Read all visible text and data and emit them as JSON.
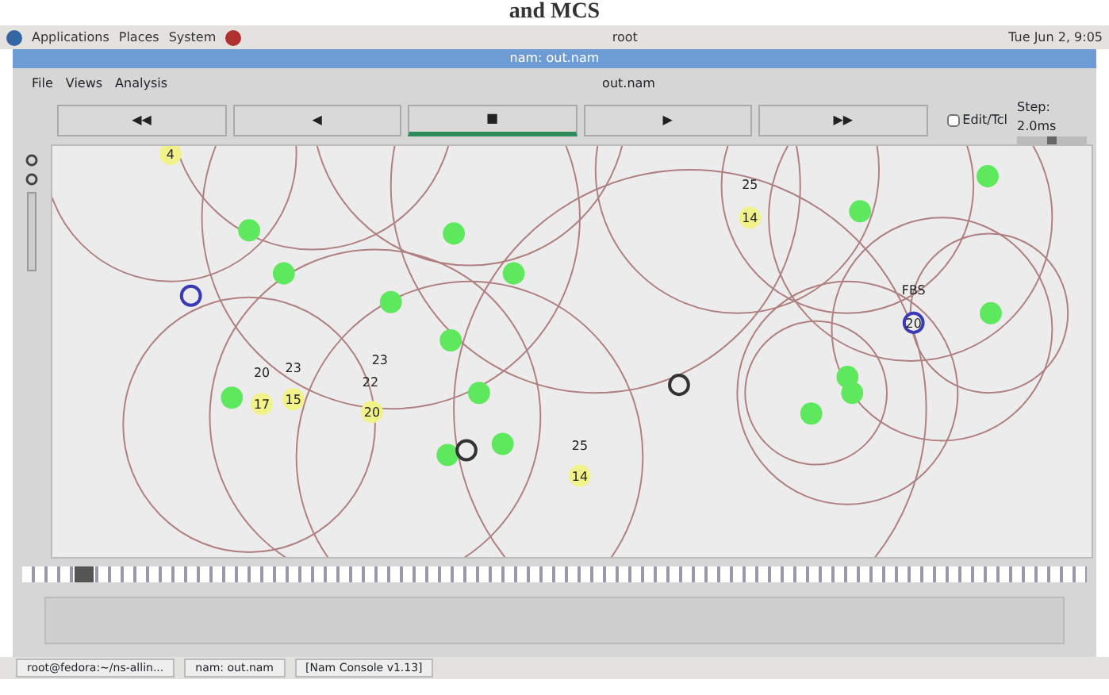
{
  "caption": "and MCS",
  "top_panel": {
    "menus": [
      "Applications",
      "Places",
      "System"
    ],
    "center": "root",
    "clock": "Tue Jun 2, 9:05"
  },
  "window": {
    "title": "nam: out.nam"
  },
  "menu_bar": {
    "items": [
      "File",
      "Views",
      "Analysis"
    ],
    "file_name": "out.nam"
  },
  "controls": [
    {
      "label": "◀◀",
      "selected": false
    },
    {
      "label": "◀",
      "selected": false
    },
    {
      "label": "■",
      "selected": true
    },
    {
      "label": "▶",
      "selected": false
    },
    {
      "label": "▶▶",
      "selected": false
    }
  ],
  "edit_toggle": {
    "label": "Edit/Tcl",
    "checked": false
  },
  "step": {
    "label": "Step: 2.0ms",
    "level": 0.5
  },
  "nodes": [
    {
      "color": "#f2f28a",
      "label": "4"
    },
    {
      "color": "#5ee85e"
    },
    {
      "color": "#5ee85e"
    },
    {
      "color": "#3a3ab8"
    },
    {
      "color": "#5ee85e"
    },
    {
      "color": "#5ee85e"
    },
    {
      "color": "#5ee85e"
    },
    {
      "color": "#5ee85e"
    },
    {
      "color": "#5ee85e"
    },
    {
      "color": "#f2f28a",
      "label": "17"
    },
    {
      "color": "#f2f28a",
      "label": "15"
    },
    {
      "color": "#f2f28a",
      "label": "20"
    },
    {
      "color": "#5ee85e"
    },
    {
      "color": "#5ee85e"
    },
    {
      "color": "#5ee85e"
    },
    {
      "color": "#333333"
    },
    {
      "color": "#f2f28a",
      "label": "14"
    },
    {
      "color": "#333333"
    },
    {
      "color": "#f2f28a",
      "label": "14"
    },
    {
      "color": "#5ee85e"
    },
    {
      "color": "#5ee85e"
    },
    {
      "color": "#5ee85e"
    },
    {
      "color": "#3a3ab8",
      "label": "20"
    },
    {
      "color": "#5ee85e"
    },
    {
      "color": "#5ee85e"
    },
    {
      "color": "#5ee85e"
    }
  ],
  "tags": [
    "20",
    "23",
    "23",
    "22",
    "25",
    "25",
    "FBS"
  ],
  "timeline": {
    "level": 0.05
  },
  "taskbar": [
    "root@fedora:~/ns-allin...",
    "nam: out.nam",
    "[Nam Console v1.13]"
  ]
}
